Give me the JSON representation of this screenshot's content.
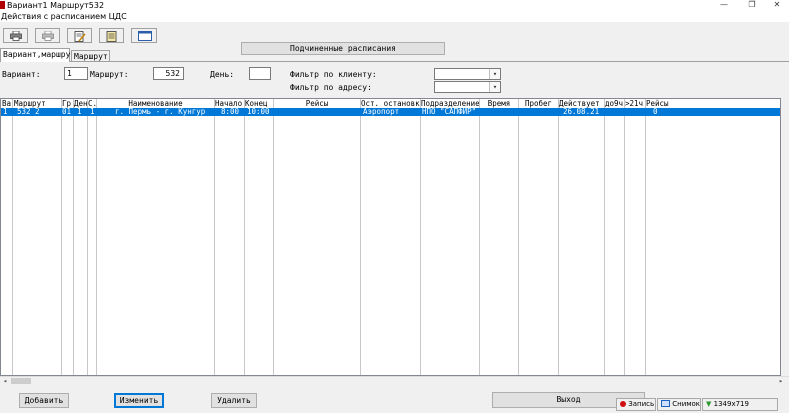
{
  "window": {
    "title": "Вариант1 Маршрут532",
    "minimize": "—",
    "maximize": "❐",
    "close": "✕"
  },
  "menu": {
    "label": "Действия с расписанием ЦДС"
  },
  "toolbar": {
    "icons": [
      "printer-icon",
      "printer-icon",
      "document-pencil-icon",
      "document-star-icon",
      "window-icon"
    ],
    "subordinate_schedules": "Подчиненные расписания"
  },
  "tabs": [
    {
      "label": "Вариант,маршрут"
    },
    {
      "label": "Маршрут"
    }
  ],
  "filters": {
    "variant_label": "Вариант:",
    "variant_value": "1",
    "route_label": "Маршрут:",
    "route_value": "532",
    "day_label": "День:",
    "day_value": "",
    "client_filter_label": "Фильтр по клиенту:",
    "client_filter_value": "",
    "address_filter_label": "Фильтр по адресу:",
    "address_filter_value": ""
  },
  "table": {
    "columns": [
      "Ва",
      "Маршрут",
      "Гр",
      "Ден",
      "С.",
      "Наименование",
      "Начало",
      "Конец",
      "Рейсы",
      "Ост. остановки",
      "Подразделение",
      "Время",
      "Пробег",
      "Действует",
      "до9ч",
      ">21ч",
      "Рейсы"
    ],
    "rows": [
      [
        "1",
        "532 2",
        "01",
        "1",
        "1",
        "г. Пермь - г. Кунгур",
        "8:00",
        "10:00",
        "",
        "Аэропорт",
        "НПО \"САПФИР\"",
        "",
        "",
        "26.08.21",
        "",
        "",
        "0"
      ]
    ]
  },
  "buttons": {
    "add": "Добавить",
    "edit": "Изменить",
    "delete": "Удалить",
    "exit": "Выход"
  },
  "recorder": {
    "record": "Запись",
    "snapshot": "Снимок",
    "resolution": "1349x719",
    "record_color": "#d01010",
    "snapshot_color": "#1f5fbf",
    "resolution_color": "#2e9a2e"
  },
  "colors": {
    "selection": "#0078d7"
  }
}
